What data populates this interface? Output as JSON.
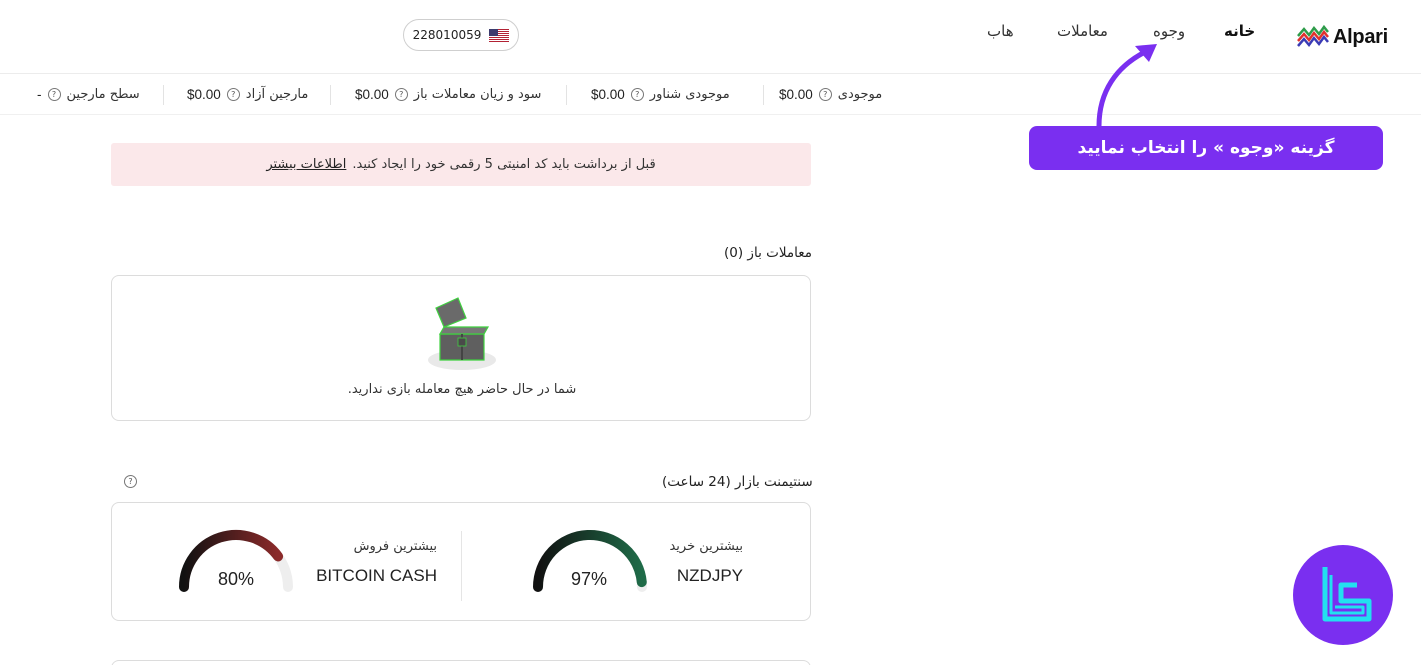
{
  "brand": {
    "name": "Alpari"
  },
  "nav": {
    "home": "خانه",
    "funds": "وجوه",
    "trades": "معاملات",
    "hub": "هاب"
  },
  "account": {
    "number": "228010059",
    "flag": "us-flag"
  },
  "stats": {
    "balance_label": "موجودی",
    "balance_value": "$0.00",
    "floating_label": "موجودی شناور",
    "floating_value": "$0.00",
    "pnl_label": "سود و زیان معاملات باز",
    "pnl_value": "$0.00",
    "free_margin_label": "مارجین آزاد",
    "free_margin_value": "$0.00",
    "margin_level_label": "سطح مارجین",
    "margin_level_value": "-"
  },
  "alert": {
    "text": "قبل از برداشت باید کد امنیتی 5 رقمی خود را ایجاد کنید.",
    "link": "اطلاعات بیشتر"
  },
  "open_trades": {
    "title": "معاملات باز (0)",
    "empty_text": "شما در حال حاضر هیچ معامله بازی ندارید."
  },
  "sentiment": {
    "title": "سنتیمنت بازار (24 ساعت)",
    "buy": {
      "label": "بیشترین خرید",
      "symbol": "NZDJPY",
      "percent_text": "97%",
      "percent": 97,
      "color": "#1f6b48"
    },
    "sell": {
      "label": "بیشترین فروش",
      "symbol": "BITCOIN CASH",
      "percent_text": "80%",
      "percent": 80,
      "color": "#8b2a2a"
    }
  },
  "callout": {
    "text": "گزینه «وجوه » را انتخاب نمایید",
    "color": "#7a2ff0"
  },
  "colors": {
    "accent": "#7a2ff0",
    "alert_bg": "#fbe8ea"
  }
}
